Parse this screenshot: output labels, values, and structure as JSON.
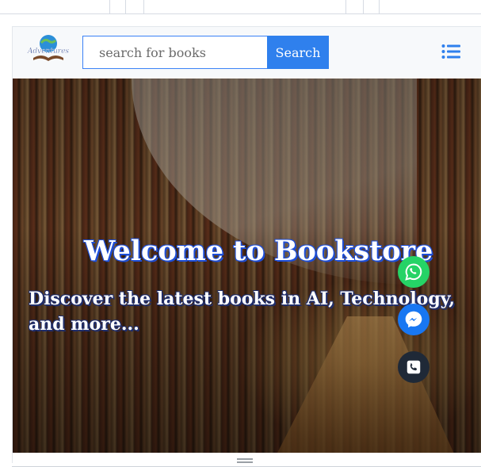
{
  "navbar": {
    "logo_text": "Adventures",
    "search": {
      "placeholder": "search for books",
      "value": ""
    },
    "search_button_label": "Search",
    "menu_icon": "list-menu-icon"
  },
  "hero": {
    "title": "Welcome to Bookstore",
    "subtitle": "Discover the latest books in AI, Technology, and more..."
  },
  "floating_buttons": [
    {
      "name": "whatsapp-icon",
      "color": "#25d366"
    },
    {
      "name": "messenger-icon",
      "color": "#1877f2"
    },
    {
      "name": "phone-icon",
      "color": "#1f2937"
    }
  ],
  "colors": {
    "accent": "#2f80ed",
    "navbar_bg": "#f7f9fb"
  }
}
